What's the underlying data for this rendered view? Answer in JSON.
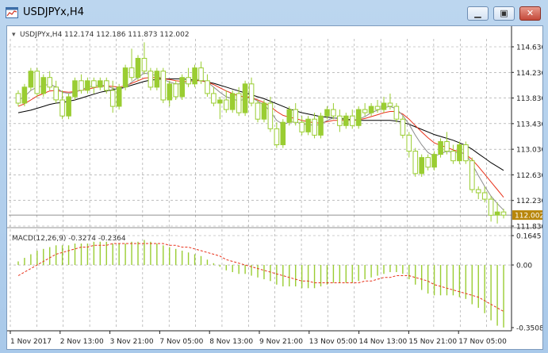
{
  "window": {
    "title": "USDJPYx,H4",
    "minimize_icon": "minimize-icon",
    "maximize_icon": "maximize-icon",
    "close_icon": "close-icon"
  },
  "chart": {
    "header": "USDJPYx,H4  112.174 112.186 111.873 112.002",
    "current_price": "112.002",
    "price_labels": [
      "114.630",
      "114.230",
      "113.830",
      "113.430",
      "113.030",
      "112.630",
      "112.230",
      "112.002",
      "111.830"
    ],
    "macd_title": "MACD(12,26,9) -0.3274 -0.2364",
    "macd_labels": [
      "0.1645",
      "0.00",
      "-0.3508"
    ],
    "time_labels": [
      "1 Nov 2017",
      "2 Nov 13:00",
      "3 Nov 21:00",
      "7 Nov 05:00",
      "8 Nov 13:00",
      "9 Nov 21:00",
      "13 Nov 05:00",
      "14 Nov 13:00",
      "15 Nov 21:00",
      "17 Nov 05:00"
    ],
    "colors": {
      "candle": "#9acd32",
      "ma_fast": "#8c8c8c",
      "ma_mid": "#e8311a",
      "ma_slow": "#000000",
      "grid": "#9a9a9a",
      "macd_hist": "#9acd32",
      "macd_signal": "#e8311a",
      "price_tag_bg": "#b8860b"
    }
  },
  "chart_data": {
    "type": "candlestick",
    "y_range": [
      111.83,
      114.63
    ],
    "macd_range": [
      -0.3508,
      0.1645
    ],
    "candles": [
      [
        113.9,
        113.95,
        113.7,
        113.75
      ],
      [
        113.75,
        114.05,
        113.7,
        114.0
      ],
      [
        114.0,
        114.3,
        113.95,
        114.25
      ],
      [
        114.25,
        114.3,
        113.85,
        113.9
      ],
      [
        113.9,
        114.2,
        113.85,
        114.15
      ],
      [
        114.15,
        114.25,
        113.95,
        114.0
      ],
      [
        114.0,
        114.1,
        113.75,
        113.8
      ],
      [
        113.8,
        113.95,
        113.5,
        113.55
      ],
      [
        113.55,
        113.9,
        113.5,
        113.85
      ],
      [
        113.85,
        114.15,
        113.8,
        114.1
      ],
      [
        114.1,
        114.2,
        113.9,
        113.95
      ],
      [
        113.95,
        114.15,
        113.9,
        114.1
      ],
      [
        114.1,
        114.15,
        113.9,
        114.0
      ],
      [
        114.0,
        114.15,
        113.95,
        114.1
      ],
      [
        114.1,
        114.15,
        113.9,
        113.95
      ],
      [
        113.95,
        114.1,
        113.6,
        113.7
      ],
      [
        113.7,
        114.05,
        113.65,
        114.0
      ],
      [
        114.0,
        114.35,
        113.95,
        114.3
      ],
      [
        114.3,
        114.6,
        114.1,
        114.15
      ],
      [
        114.15,
        114.5,
        114.1,
        114.45
      ],
      [
        114.45,
        114.7,
        114.2,
        114.25
      ],
      [
        114.25,
        114.3,
        113.95,
        114.0
      ],
      [
        114.0,
        114.3,
        113.95,
        114.25
      ],
      [
        114.25,
        114.3,
        113.75,
        113.8
      ],
      [
        113.8,
        114.1,
        113.7,
        114.05
      ],
      [
        114.05,
        114.1,
        113.8,
        113.85
      ],
      [
        113.85,
        114.2,
        113.8,
        114.15
      ],
      [
        114.15,
        114.3,
        114.0,
        114.05
      ],
      [
        114.05,
        114.35,
        114.0,
        114.3
      ],
      [
        114.3,
        114.4,
        114.05,
        114.1
      ],
      [
        114.1,
        114.2,
        113.85,
        113.9
      ],
      [
        113.9,
        114.0,
        113.7,
        113.75
      ],
      [
        113.75,
        113.85,
        113.5,
        113.8
      ],
      [
        113.8,
        113.95,
        113.6,
        113.65
      ],
      [
        113.65,
        113.95,
        113.6,
        113.9
      ],
      [
        113.9,
        114.0,
        113.55,
        113.6
      ],
      [
        113.6,
        114.1,
        113.55,
        114.05
      ],
      [
        114.05,
        114.15,
        113.7,
        113.75
      ],
      [
        113.75,
        113.8,
        113.45,
        113.5
      ],
      [
        113.5,
        113.8,
        113.45,
        113.75
      ],
      [
        113.75,
        113.85,
        113.3,
        113.35
      ],
      [
        113.35,
        113.45,
        113.05,
        113.1
      ],
      [
        113.1,
        113.5,
        113.05,
        113.45
      ],
      [
        113.45,
        113.7,
        113.4,
        113.65
      ],
      [
        113.65,
        113.75,
        113.4,
        113.45
      ],
      [
        113.45,
        113.55,
        113.25,
        113.3
      ],
      [
        113.3,
        113.55,
        113.25,
        113.5
      ],
      [
        113.5,
        113.6,
        113.2,
        113.25
      ],
      [
        113.25,
        113.6,
        113.2,
        113.55
      ],
      [
        113.55,
        113.7,
        113.5,
        113.65
      ],
      [
        113.65,
        113.75,
        113.5,
        113.55
      ],
      [
        113.55,
        113.65,
        113.3,
        113.4
      ],
      [
        113.4,
        113.6,
        113.35,
        113.55
      ],
      [
        113.55,
        113.65,
        113.35,
        113.4
      ],
      [
        113.4,
        113.7,
        113.35,
        113.65
      ],
      [
        113.65,
        113.75,
        113.55,
        113.6
      ],
      [
        113.6,
        113.75,
        113.55,
        113.7
      ],
      [
        113.7,
        113.8,
        113.6,
        113.65
      ],
      [
        113.65,
        113.85,
        113.6,
        113.75
      ],
      [
        113.75,
        113.9,
        113.65,
        113.7
      ],
      [
        113.7,
        113.75,
        113.45,
        113.5
      ],
      [
        113.5,
        113.55,
        113.2,
        113.25
      ],
      [
        113.25,
        113.3,
        112.9,
        113.0
      ],
      [
        113.0,
        113.05,
        112.6,
        112.65
      ],
      [
        112.65,
        112.95,
        112.6,
        112.9
      ],
      [
        112.9,
        112.95,
        112.7,
        112.75
      ],
      [
        112.75,
        113.0,
        112.7,
        112.95
      ],
      [
        112.95,
        113.2,
        112.9,
        113.15
      ],
      [
        113.15,
        113.3,
        112.95,
        113.0
      ],
      [
        113.0,
        113.1,
        112.8,
        112.85
      ],
      [
        112.85,
        113.15,
        112.8,
        113.1
      ],
      [
        113.1,
        113.15,
        112.8,
        112.85
      ],
      [
        112.85,
        112.9,
        112.35,
        112.4
      ],
      [
        112.4,
        112.45,
        112.25,
        112.35
      ],
      [
        112.35,
        112.45,
        112.2,
        112.25
      ],
      [
        112.25,
        112.3,
        111.9,
        112.0
      ],
      [
        112.0,
        112.2,
        111.87,
        112.05
      ],
      [
        112.05,
        112.1,
        111.95,
        112.0
      ]
    ],
    "ma_fast": [
      113.8,
      113.85,
      113.95,
      114.0,
      114.02,
      114.05,
      114.0,
      113.92,
      113.9,
      113.92,
      113.96,
      114.0,
      114.02,
      114.03,
      114.02,
      113.98,
      113.96,
      114.0,
      114.08,
      114.15,
      114.22,
      114.2,
      114.18,
      114.12,
      114.08,
      114.05,
      114.05,
      114.08,
      114.12,
      114.12,
      114.08,
      114.0,
      113.92,
      113.85,
      113.82,
      113.78,
      113.82,
      113.84,
      113.78,
      113.72,
      113.62,
      113.48,
      113.42,
      113.45,
      113.46,
      113.42,
      113.42,
      113.4,
      113.42,
      113.48,
      113.52,
      113.5,
      113.49,
      113.48,
      113.5,
      113.54,
      113.6,
      113.64,
      113.68,
      113.7,
      113.66,
      113.56,
      113.42,
      113.25,
      113.1,
      112.98,
      112.92,
      112.96,
      113.0,
      112.98,
      112.98,
      112.96,
      112.8,
      112.62,
      112.45,
      112.3,
      112.18,
      112.08
    ],
    "ma_mid": [
      113.7,
      113.74,
      113.8,
      113.86,
      113.9,
      113.94,
      113.95,
      113.93,
      113.92,
      113.93,
      113.95,
      113.97,
      113.99,
      114.01,
      114.02,
      114.01,
      114.0,
      114.02,
      114.06,
      114.1,
      114.14,
      114.15,
      114.15,
      114.13,
      114.12,
      114.1,
      114.09,
      114.09,
      114.1,
      114.1,
      114.08,
      114.04,
      113.99,
      113.94,
      113.9,
      113.86,
      113.85,
      113.84,
      113.8,
      113.76,
      113.7,
      113.62,
      113.56,
      113.53,
      113.51,
      113.48,
      113.46,
      113.44,
      113.44,
      113.46,
      113.48,
      113.48,
      113.48,
      113.48,
      113.49,
      113.51,
      113.54,
      113.57,
      113.6,
      113.62,
      113.62,
      113.58,
      113.5,
      113.4,
      113.3,
      113.21,
      113.13,
      113.09,
      113.06,
      113.02,
      112.99,
      112.95,
      112.87,
      112.76,
      112.64,
      112.52,
      112.4,
      112.28
    ],
    "ma_slow": [
      113.6,
      113.62,
      113.64,
      113.67,
      113.7,
      113.73,
      113.75,
      113.76,
      113.78,
      113.8,
      113.83,
      113.86,
      113.89,
      113.92,
      113.94,
      113.96,
      113.98,
      114.0,
      114.03,
      114.06,
      114.09,
      114.11,
      114.12,
      114.13,
      114.13,
      114.13,
      114.13,
      114.12,
      114.11,
      114.1,
      114.08,
      114.06,
      114.03,
      114.0,
      113.97,
      113.94,
      113.91,
      113.88,
      113.85,
      113.82,
      113.78,
      113.74,
      113.7,
      113.66,
      113.63,
      113.6,
      113.58,
      113.56,
      113.54,
      113.53,
      113.52,
      113.51,
      113.5,
      113.49,
      113.48,
      113.48,
      113.48,
      113.48,
      113.48,
      113.48,
      113.47,
      113.45,
      113.42,
      113.38,
      113.34,
      113.3,
      113.26,
      113.23,
      113.2,
      113.17,
      113.13,
      113.09,
      113.03,
      112.96,
      112.89,
      112.82,
      112.76,
      112.7
    ],
    "macd_hist": [
      0.02,
      0.04,
      0.06,
      0.08,
      0.09,
      0.1,
      0.11,
      0.11,
      0.11,
      0.12,
      0.12,
      0.12,
      0.13,
      0.13,
      0.13,
      0.12,
      0.12,
      0.12,
      0.13,
      0.13,
      0.14,
      0.13,
      0.12,
      0.11,
      0.1,
      0.09,
      0.08,
      0.07,
      0.06,
      0.05,
      0.03,
      0.01,
      -0.01,
      -0.03,
      -0.04,
      -0.05,
      -0.05,
      -0.06,
      -0.07,
      -0.08,
      -0.09,
      -0.11,
      -0.12,
      -0.12,
      -0.12,
      -0.13,
      -0.13,
      -0.13,
      -0.12,
      -0.11,
      -0.1,
      -0.1,
      -0.1,
      -0.1,
      -0.09,
      -0.08,
      -0.07,
      -0.06,
      -0.05,
      -0.04,
      -0.04,
      -0.05,
      -0.08,
      -0.11,
      -0.14,
      -0.16,
      -0.17,
      -0.17,
      -0.17,
      -0.17,
      -0.18,
      -0.19,
      -0.22,
      -0.24,
      -0.27,
      -0.31,
      -0.34,
      -0.35
    ],
    "macd_signal": [
      -0.06,
      -0.04,
      -0.02,
      0.0,
      0.02,
      0.04,
      0.06,
      0.07,
      0.08,
      0.09,
      0.1,
      0.1,
      0.11,
      0.11,
      0.11,
      0.12,
      0.12,
      0.12,
      0.12,
      0.12,
      0.12,
      0.12,
      0.12,
      0.12,
      0.11,
      0.11,
      0.1,
      0.1,
      0.09,
      0.08,
      0.07,
      0.06,
      0.05,
      0.03,
      0.02,
      0.01,
      0.0,
      -0.01,
      -0.02,
      -0.03,
      -0.04,
      -0.05,
      -0.06,
      -0.07,
      -0.08,
      -0.09,
      -0.09,
      -0.1,
      -0.1,
      -0.1,
      -0.1,
      -0.1,
      -0.1,
      -0.1,
      -0.1,
      -0.09,
      -0.09,
      -0.08,
      -0.07,
      -0.07,
      -0.06,
      -0.06,
      -0.06,
      -0.07,
      -0.08,
      -0.09,
      -0.11,
      -0.12,
      -0.13,
      -0.14,
      -0.15,
      -0.16,
      -0.17,
      -0.18,
      -0.2,
      -0.22,
      -0.24,
      -0.26
    ]
  }
}
